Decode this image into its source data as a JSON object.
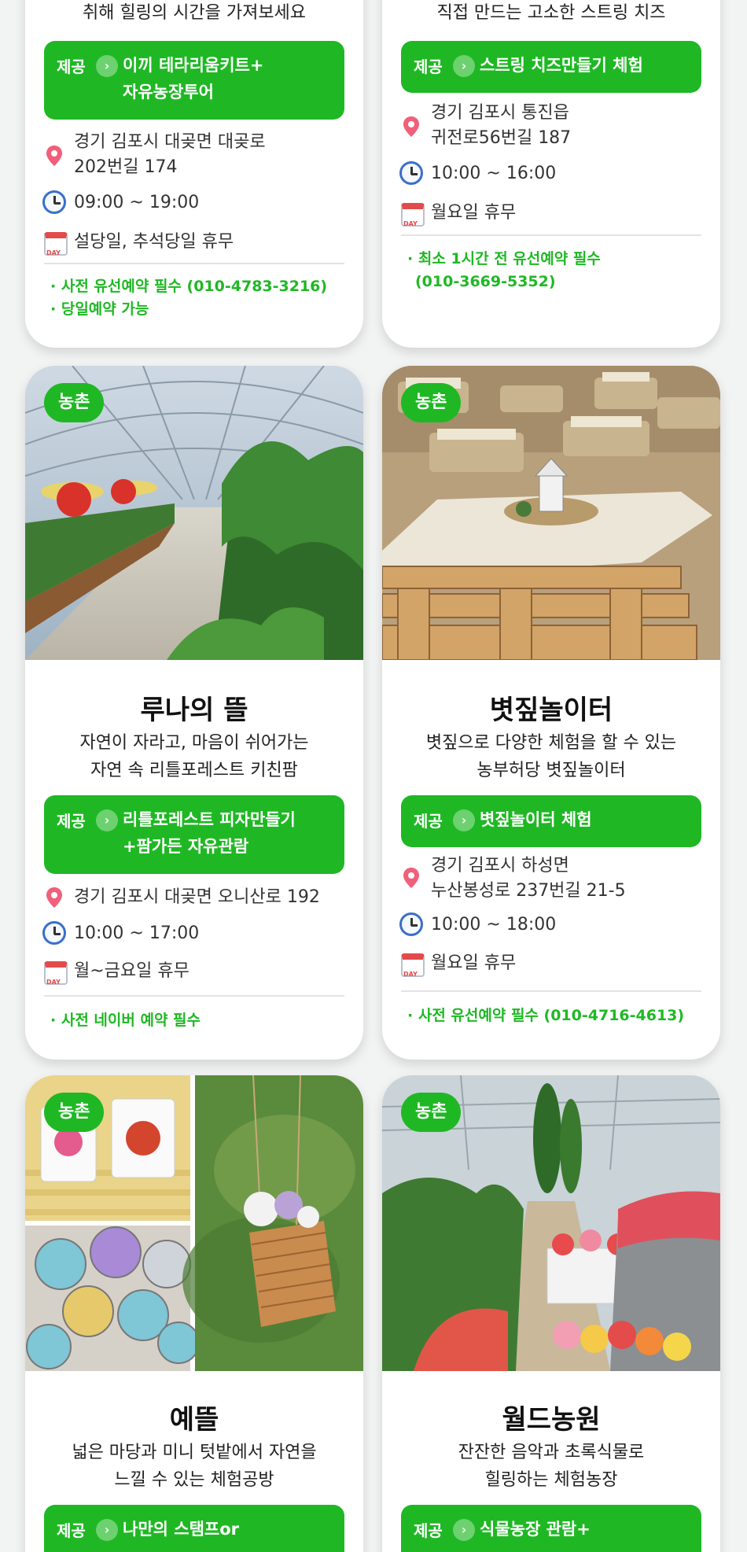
{
  "cards": [
    {
      "desc": [
        "취해 힐링의 시간을 가져보세요"
      ],
      "offer_label": "제공",
      "offer": [
        "이끼 테라리움키트+",
        "자유농장투어"
      ],
      "address": [
        "경기 김포시 대곶면 대곶로",
        "202번길 174"
      ],
      "hours": "09:00 ~ 19:00",
      "closed": "설당일, 추석당일 휴무",
      "notes": [
        "· 사전 유선예약 필수 (010-4783-3216)",
        "· 당일예약 가능"
      ]
    },
    {
      "desc": [
        "직접 만드는 고소한 스트링 치즈"
      ],
      "offer_label": "제공",
      "offer": [
        "스트링 치즈만들기 체험"
      ],
      "address": [
        "경기 김포시 통진읍",
        "귀전로56번길 187"
      ],
      "hours": "10:00 ~ 16:00",
      "closed": "월요일 휴무",
      "notes": [
        "· 최소 1시간 전 유선예약 필수",
        "(010-3669-5352)"
      ]
    },
    {
      "badge": "농촌",
      "title": "루나의 뜰",
      "desc": [
        "자연이 자라고, 마음이 쉬어가는",
        "자연 속 리틀포레스트 키친팜"
      ],
      "offer_label": "제공",
      "offer": [
        "리틀포레스트 피자만들기",
        "+팜가든 자유관람"
      ],
      "address": [
        "경기 김포시 대곶면 오니산로 192"
      ],
      "hours": "10:00 ~ 17:00",
      "closed": "월~금요일 휴무",
      "notes": [
        "· 사전 네이버 예약 필수"
      ]
    },
    {
      "badge": "농촌",
      "title": "볏짚놀이터",
      "desc": [
        "볏짚으로 다양한 체험을 할 수 있는",
        "농부허당 볏짚놀이터"
      ],
      "offer_label": "제공",
      "offer": [
        "볏짚놀이터 체험"
      ],
      "address": [
        "경기 김포시 하성면",
        "누산봉성로 237번길 21-5"
      ],
      "hours": "10:00 ~ 18:00",
      "closed": "월요일 휴무",
      "notes": [
        "· 사전 유선예약 필수 (010-4716-4613)"
      ]
    },
    {
      "badge": "농촌",
      "title": "예뜰",
      "desc": [
        "넓은 마당과 미니 텃밭에서 자연을",
        "느낄 수 있는 체험공방"
      ],
      "offer_label": "제공",
      "offer": [
        "나만의 스탬프or"
      ]
    },
    {
      "badge": "농촌",
      "title": "월드농원",
      "desc": [
        "잔잔한 음악과 초록식물로",
        "힐링하는 체험농장"
      ],
      "offer_label": "제공",
      "offer": [
        "식물농장 관람+"
      ]
    }
  ],
  "icons": {
    "address": "location-pin-icon",
    "hours": "clock-icon",
    "closed": "calendar-icon",
    "offer": "chevron-right-circle-icon"
  },
  "colors": {
    "accent": "#1fb824",
    "background": "#f2f3f3",
    "card": "#ffffff"
  }
}
